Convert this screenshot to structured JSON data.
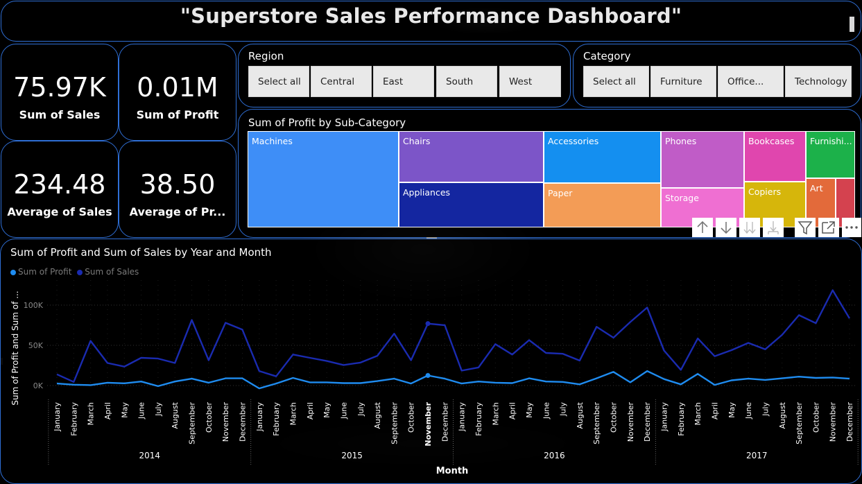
{
  "dashboard_title": "\"Superstore Sales Performance Dashboard\"",
  "kpis": {
    "sum_sales": {
      "value": "75.97K",
      "label": "Sum of Sales"
    },
    "sum_profit": {
      "value": "0.01M",
      "label": "Sum of Profit"
    },
    "avg_sales": {
      "value": "234.48",
      "label": "Average of Sales"
    },
    "avg_profit": {
      "value": "38.50",
      "label": "Average of Pr..."
    }
  },
  "region_slicer": {
    "title": "Region",
    "options": [
      "Select all",
      "Central",
      "East",
      "South",
      "West"
    ]
  },
  "category_slicer": {
    "title": "Category",
    "options": [
      "Select all",
      "Furniture",
      "Office...",
      "Technology"
    ]
  },
  "treemap": {
    "title": "Sum of Profit by Sub-Category",
    "tiles": [
      {
        "label": "Machines",
        "color": "#3e8ef7"
      },
      {
        "label": "Chairs",
        "color": "#7c55c8"
      },
      {
        "label": "Appliances",
        "color": "#1426a0"
      },
      {
        "label": "Accessories",
        "color": "#148ff0"
      },
      {
        "label": "Paper",
        "color": "#f39c56"
      },
      {
        "label": "Phones",
        "color": "#c05cc7"
      },
      {
        "label": "Storage",
        "color": "#ef6fd2"
      },
      {
        "label": "Bookcases",
        "color": "#e046ae"
      },
      {
        "label": "Copiers",
        "color": "#d6b60b"
      },
      {
        "label": "Furnishi...",
        "color": "#1cb14a"
      },
      {
        "label": "Art",
        "color": "#e36a3a"
      },
      {
        "label": "",
        "color": "#d4424f"
      }
    ],
    "tool_icons": [
      "arrow-up-icon",
      "arrow-down-icon",
      "double-arrow-down-icon",
      "expand-hierarchy-icon",
      "filter-icon",
      "focus-mode-icon",
      "more-options-icon"
    ]
  },
  "chart_data": {
    "type": "line",
    "title": "Sum of Profit and Sum of Sales by Year and Month",
    "xlabel": "Month",
    "ylabel": "Sum of Profit and Sum of ...",
    "ylim": [
      0,
      120000
    ],
    "yticks": [
      "0K",
      "50K",
      "100K"
    ],
    "legend_position": "top-left",
    "grid": true,
    "years": [
      "2014",
      "2015",
      "2016",
      "2017"
    ],
    "categories": [
      "January",
      "February",
      "March",
      "April",
      "May",
      "June",
      "July",
      "August",
      "September",
      "October",
      "November",
      "December",
      "January",
      "February",
      "March",
      "April",
      "May",
      "June",
      "July",
      "August",
      "September",
      "October",
      "November",
      "December",
      "January",
      "February",
      "March",
      "April",
      "May",
      "June",
      "July",
      "August",
      "September",
      "October",
      "November",
      "December",
      "January",
      "February",
      "March",
      "April",
      "May",
      "June",
      "July",
      "August",
      "September",
      "October",
      "November",
      "December"
    ],
    "highlighted_category_index": 22,
    "series": [
      {
        "name": "Sum of Profit",
        "color": "#1f8cf0",
        "values": [
          2500,
          1000,
          500,
          3500,
          2800,
          5000,
          -800,
          5000,
          8500,
          3500,
          9000,
          9000,
          -3500,
          2500,
          9500,
          4000,
          4000,
          3000,
          3000,
          5500,
          8500,
          2500,
          12500,
          8500,
          2500,
          5000,
          3500,
          3000,
          9000,
          5000,
          4500,
          1500,
          9000,
          17000,
          4000,
          18000,
          8000,
          1500,
          14500,
          800,
          6500,
          8500,
          7000,
          9000,
          11000,
          9500,
          10000,
          8500
        ]
      },
      {
        "name": "Sum of Sales",
        "color": "#1a2bb0",
        "values": [
          14000,
          4500,
          55500,
          28000,
          23500,
          34500,
          33500,
          28000,
          81500,
          31500,
          78000,
          69500,
          18000,
          11500,
          38500,
          34500,
          30500,
          25500,
          28500,
          37000,
          64500,
          31500,
          77000,
          75000,
          18500,
          22500,
          51500,
          38500,
          56500,
          40500,
          39500,
          31000,
          73000,
          59500,
          79000,
          97000,
          43500,
          19500,
          58500,
          36500,
          44000,
          53000,
          45000,
          63000,
          87500,
          77500,
          118500,
          83500
        ]
      }
    ]
  }
}
